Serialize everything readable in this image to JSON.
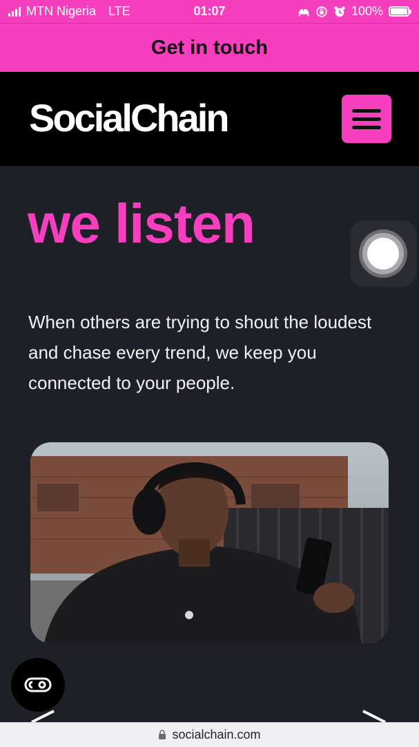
{
  "status_bar": {
    "carrier": "MTN Nigeria",
    "network": "LTE",
    "time": "01:07",
    "battery": "100%",
    "battery_level": 1.0
  },
  "contact_bar": {
    "label": "Get in touch"
  },
  "header": {
    "logo_text": "SocialChain",
    "menu_icon": "hamburger-menu-icon"
  },
  "main": {
    "heading": "we listen",
    "body": "When others are trying to shout the loudest and chase every trend, we keep you connected to your people.",
    "image_alt_icon": "photo-person-headphones"
  },
  "controls": {
    "captions_icon": "closed-captions-icon",
    "prev_icon": "chevron-left-icon",
    "next_icon": "chevron-right-icon"
  },
  "browser": {
    "url": "socialchain.com",
    "lock_icon": "lock-icon"
  },
  "colors": {
    "accent": "#f63fbf",
    "page_bg": "#1f1f27",
    "header_bg": "#000000",
    "text": "#f2f2f2"
  }
}
